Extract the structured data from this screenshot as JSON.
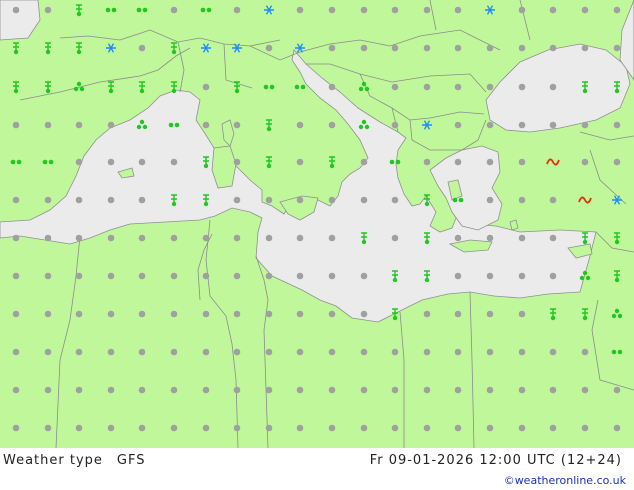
{
  "map": {
    "region": "Mediterranean",
    "colors": {
      "land": "#c0f79a",
      "sea": "#ebebeb",
      "border": "#8c8c8c",
      "coast": "#909090",
      "dry_dot": "#a0a0a0",
      "rain": "#1ec81e",
      "snow": "#1a8cff",
      "thunder": "#e03010"
    },
    "legend_symbols": [
      "dry-dot",
      "rain-drop",
      "rain-shower",
      "drizzle",
      "snow",
      "snow-shower",
      "thunderstorm"
    ]
  },
  "footer": {
    "title": "Weather type",
    "model": "GFS",
    "valid_time": "Fr 09-01-2026 12:00 UTC (12+24)",
    "credit": "©weatheronline.co.uk"
  }
}
